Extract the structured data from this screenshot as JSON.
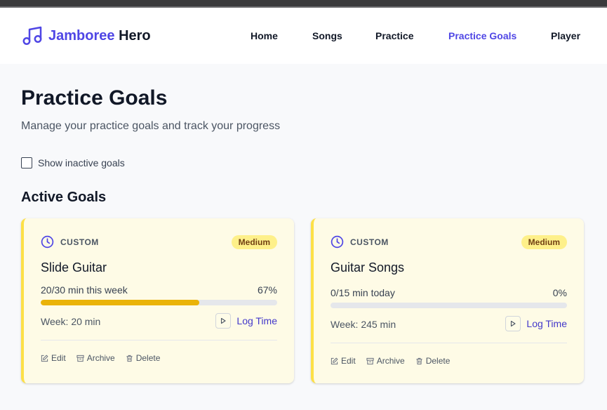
{
  "brand": {
    "part1": "Jamboree",
    "part2": "Hero",
    "icon": "music-note-icon",
    "accent": "#4f46e5"
  },
  "nav": {
    "items": [
      {
        "label": "Home"
      },
      {
        "label": "Songs"
      },
      {
        "label": "Practice"
      },
      {
        "label": "Practice Goals"
      },
      {
        "label": "Player"
      }
    ],
    "active": "Practice Goals"
  },
  "page": {
    "title": "Practice Goals",
    "subtitle": "Manage your practice goals and track your progress"
  },
  "filter": {
    "show_inactive_label": "Show inactive goals",
    "checked": false
  },
  "section": {
    "active_title": "Active Goals"
  },
  "goals": [
    {
      "type": "CUSTOM",
      "priority": "Medium",
      "title": "Slide Guitar",
      "progress_text": "20/30 min this week",
      "percent_text": "67%",
      "progress": 0.67,
      "week_text": "Week: 20 min",
      "log_label": "Log Time",
      "edit": "Edit",
      "archive": "Archive",
      "delete": "Delete"
    },
    {
      "type": "CUSTOM",
      "priority": "Medium",
      "title": "Guitar Songs",
      "progress_text": "0/15 min today",
      "percent_text": "0%",
      "progress": 0,
      "week_text": "Week: 245 min",
      "log_label": "Log Time",
      "edit": "Edit",
      "archive": "Archive",
      "delete": "Delete"
    }
  ],
  "colors": {
    "card_bg": "#fefbe6",
    "card_border": "#fde047",
    "progress": "#eab308",
    "badge_bg": "#fef08a",
    "link": "#4338ca"
  }
}
